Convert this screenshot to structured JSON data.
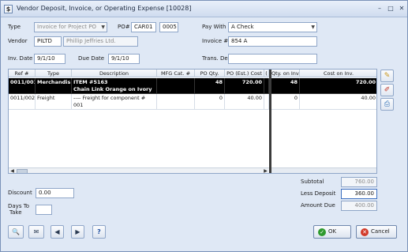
{
  "window": {
    "title": "Vendor Deposit, Invoice, or Operating Expense [10028]",
    "minimize": "–",
    "maximize": "□",
    "close": "✕"
  },
  "form": {
    "type_label": "Type",
    "type_value": "Invoice for Project PO",
    "po_label": "PO#",
    "po_value1": "CAR01",
    "po_value2": "0005",
    "paywith_label": "Pay With",
    "paywith_value": "A Check",
    "vendor_label": "Vendor",
    "vendor_code": "PILTD",
    "vendor_name": "Phillip Jeffries Ltd.",
    "invoice_label": "Invoice #",
    "invoice_value": "854 A",
    "invdate_label": "Inv. Date",
    "invdate_value": "9/1/10",
    "duedate_label": "Due Date",
    "duedate_value": "9/1/10",
    "transdesc_label": "Trans. Desc",
    "transdesc_value": ""
  },
  "grid": {
    "columns": [
      "Ref #",
      "Type",
      "Description",
      "MFG Cat. #",
      "PO Qty.",
      "PO (Est.) Cost",
      "(",
      "Qty. on Inv.",
      "Cost on Inv."
    ],
    "rows": [
      {
        "ref": "0011/001",
        "type": "Merchandis",
        "desc1": "ITEM #5163",
        "desc2": "Chain Link Orange on Ivory",
        "mfg": "",
        "po_qty": "48",
        "po_cost": "720.00",
        "qty_inv": "48",
        "cost_inv": "720.00"
      },
      {
        "ref": "0011/002",
        "type": "Freight",
        "desc1": "---- Freight for component #",
        "desc2": "001",
        "mfg": "",
        "po_qty": "0",
        "po_cost": "40.00",
        "qty_inv": "0",
        "cost_inv": "40.00"
      }
    ]
  },
  "bottom": {
    "discount_label": "Discount",
    "discount_value": "0.00",
    "days_label_1": "Days To",
    "days_label_2": "Take",
    "days_value": "",
    "subtotal_label": "Subtotal",
    "subtotal_value": "760.00",
    "less_deposit_label": "Less Deposit",
    "less_deposit_value": "360.00",
    "amount_due_label": "Amount Due",
    "amount_due_value": "400.00"
  },
  "buttons": {
    "ok": "OK",
    "cancel": "Cancel",
    "help": "?"
  },
  "colors": {
    "ok_icon": "#2e9a2e",
    "cancel_icon": "#d23a2a"
  }
}
